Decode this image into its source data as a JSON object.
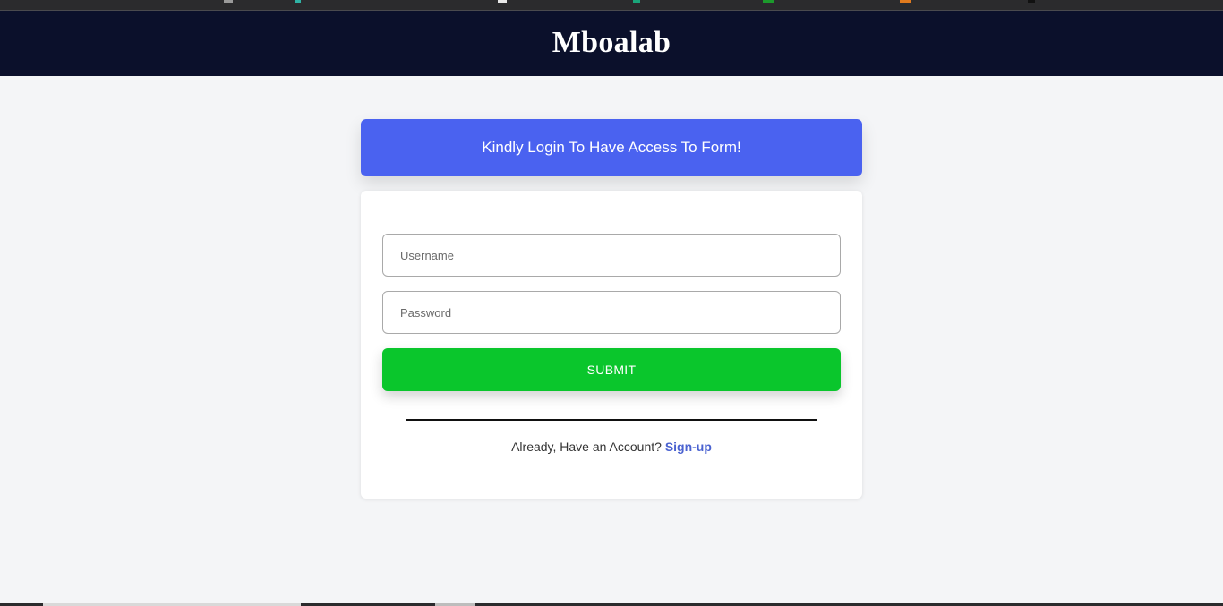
{
  "header": {
    "brand": "Mboalab",
    "background_color": "#0b102b"
  },
  "banner": {
    "text": "Kindly Login To Have Access To Form!",
    "color": "#4a62f0"
  },
  "form": {
    "username": {
      "placeholder": "Username",
      "value": ""
    },
    "password": {
      "placeholder": "Password",
      "value": ""
    },
    "submit_label": "SUBMIT",
    "submit_color": "#0ac62c"
  },
  "footer": {
    "prompt_text": "Already, Have an Account?",
    "signup_label": "Sign-up",
    "link_color": "#4a62d0"
  },
  "page": {
    "background_color": "#f4f5f7"
  }
}
